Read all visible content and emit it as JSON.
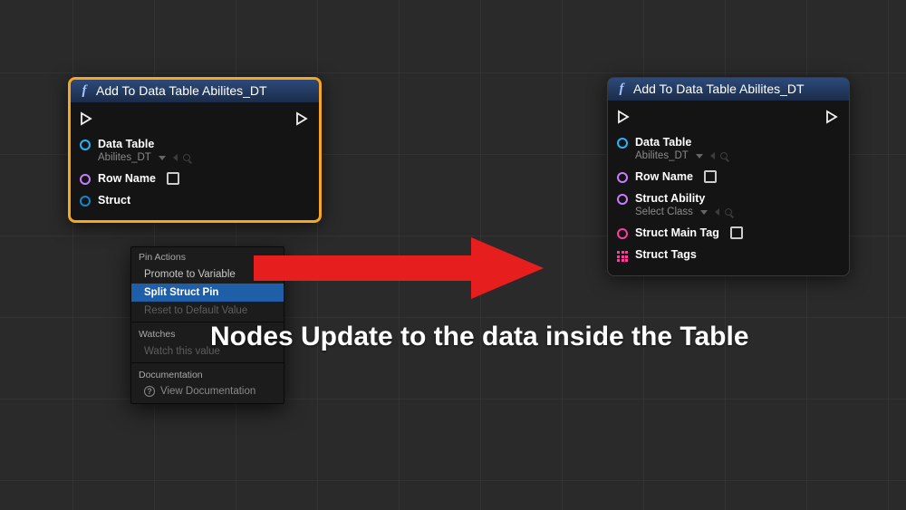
{
  "node_left": {
    "title": "Add To Data Table Abilites_DT",
    "pins": {
      "data_table": {
        "label": "Data Table",
        "value": "Abilites_DT"
      },
      "row_name": {
        "label": "Row Name"
      },
      "struct": {
        "label": "Struct"
      }
    }
  },
  "node_right": {
    "title": "Add To Data Table Abilites_DT",
    "pins": {
      "data_table": {
        "label": "Data Table",
        "value": "Abilites_DT"
      },
      "row_name": {
        "label": "Row Name"
      },
      "struct_ability": {
        "label": "Struct Ability",
        "value": "Select Class"
      },
      "struct_main_tag": {
        "label": "Struct Main Tag"
      },
      "struct_tags": {
        "label": "Struct Tags"
      }
    }
  },
  "context_menu": {
    "sections": {
      "pin_actions": {
        "title": "Pin Actions",
        "items": {
          "promote": "Promote to Variable",
          "split": "Split Struct Pin",
          "reset": "Reset to Default Value"
        }
      },
      "watches": {
        "title": "Watches",
        "items": {
          "watch": "Watch this value"
        }
      },
      "documentation": {
        "title": "Documentation",
        "items": {
          "view": "View Documentation"
        }
      }
    }
  },
  "caption": "Nodes Update to the data inside the Table"
}
